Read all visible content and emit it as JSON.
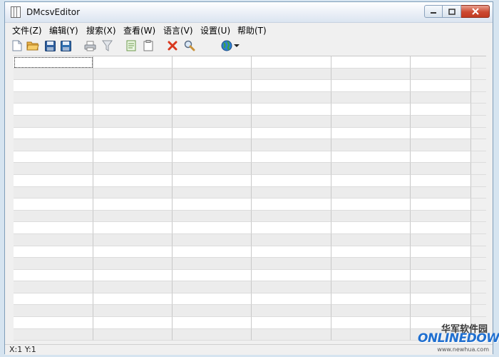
{
  "window": {
    "title": "DMcsvEditor",
    "controls": {
      "minimize": "▭",
      "maximize": "▢",
      "close": "✕"
    }
  },
  "menu": [
    {
      "label": "文件(Z)"
    },
    {
      "label": "编辑(Y)"
    },
    {
      "label": "搜索(X)"
    },
    {
      "label": "查看(W)"
    },
    {
      "label": "语言(V)"
    },
    {
      "label": "设置(U)"
    },
    {
      "label": "帮助(T)"
    }
  ],
  "toolbar": [
    {
      "icon": "new-file-icon"
    },
    {
      "icon": "open-folder-icon"
    },
    {
      "icon": "save-icon"
    },
    {
      "icon": "save-as-icon"
    },
    {
      "icon": "print-icon"
    },
    {
      "icon": "filter-icon"
    },
    {
      "icon": "copy-icon"
    },
    {
      "icon": "paste-icon"
    },
    {
      "icon": "delete-icon"
    },
    {
      "icon": "search-icon"
    },
    {
      "icon": "globe-icon"
    },
    {
      "icon": "dropdown-arrow-icon"
    }
  ],
  "grid": {
    "rows": 24,
    "columns": 6
  },
  "status": {
    "position": "X:1  Y:1"
  },
  "watermark": {
    "chinese": "华军软件园",
    "logo_prefix": "",
    "logo": "ONLINEDOWN",
    "url": "www.newhua.com"
  },
  "colors": {
    "row_alt": "#ececec",
    "grid_line": "#c8c8c8",
    "close_button": "#c23b22",
    "delete_icon": "#d9381e"
  }
}
